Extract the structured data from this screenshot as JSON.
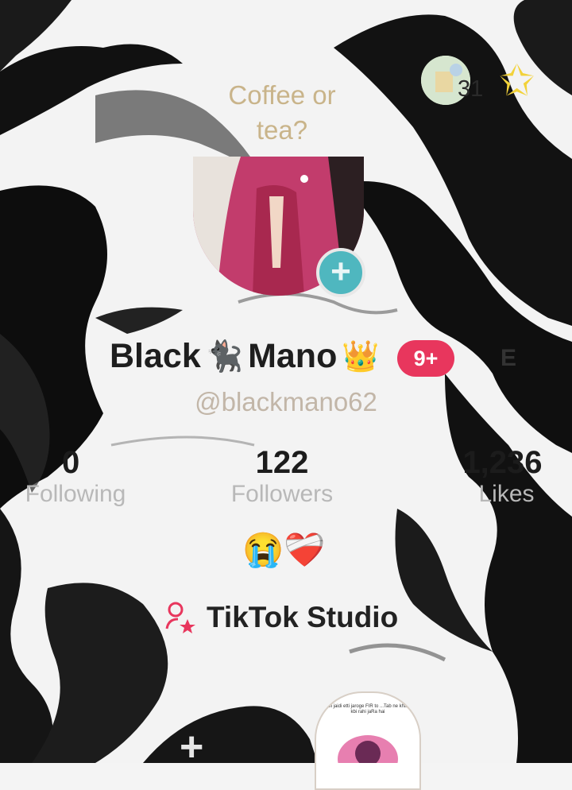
{
  "profile": {
    "prompt_line1": "Coffee or",
    "prompt_line2": "tea?",
    "name_part1": "Black",
    "name_part2": "Mano",
    "cat_emoji": "🐈‍⬛",
    "crown_emoji": "👑",
    "notification_badge": "9+",
    "edit_partial": "E",
    "username": "@blackmano62",
    "bio_emojis": "😭❤️‍🩹"
  },
  "badge": {
    "count": "31"
  },
  "stats": [
    {
      "value": "0",
      "label": "Following"
    },
    {
      "value": "122",
      "label": "Followers"
    },
    {
      "value": "1,236",
      "label": "Likes"
    }
  ],
  "studio": {
    "label": "TikTok Studio",
    "icon": "person-star-icon"
  },
  "post_preview": {
    "caption": "...dil jaidi etti jaroge FIR to ...Tab ne khana kbi rahi jaRa hai"
  },
  "colors": {
    "accent": "#e8365d",
    "add_button": "#4fb7bf",
    "prompt_text": "#c9b48a",
    "muted": "#b8b8b8"
  }
}
